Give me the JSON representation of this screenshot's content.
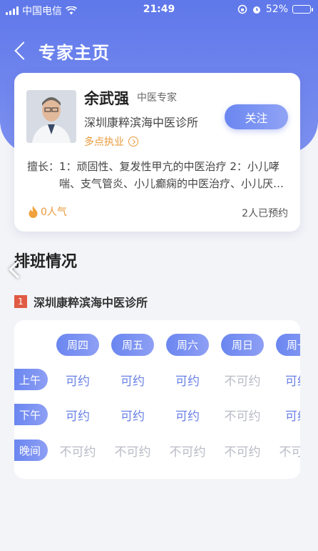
{
  "status_bar": {
    "carrier": "中国电信",
    "time": "21:49",
    "battery": "52%",
    "battery_level": 0.52
  },
  "nav": {
    "title": "专家主页"
  },
  "doctor": {
    "name": "余武强",
    "title": "中医专家",
    "hospital": "深圳康粹滨海中医诊所",
    "multi_practice": "多点执业",
    "follow_label": "关注",
    "skills_label": "擅长：",
    "skills_text": "1：顽固性、复发性甲亢的中医治疗 2：小儿哮喘、支气管炎、小儿癫痫的中医治疗、小儿厌食等",
    "popularity": "0人气",
    "booked": "2人已预约"
  },
  "schedule": {
    "section_title": "排班情况",
    "clinic_index": "1",
    "clinic_name": "深圳康粹滨海中医诊所",
    "days": [
      "周四",
      "周五",
      "周六",
      "周日",
      "周一"
    ],
    "periods": [
      {
        "label": "上午",
        "slots": [
          "可约",
          "可约",
          "可约",
          "不可约",
          "可约"
        ]
      },
      {
        "label": "下午",
        "slots": [
          "可约",
          "可约",
          "可约",
          "不可约",
          "可约"
        ]
      },
      {
        "label": "晚间",
        "slots": [
          "不可约",
          "不可约",
          "不可约",
          "不可约",
          "不可约"
        ]
      }
    ]
  },
  "colors": {
    "primary": "#6a86f0",
    "accent_orange": "#e8993a",
    "badge_red": "#e05a44"
  }
}
